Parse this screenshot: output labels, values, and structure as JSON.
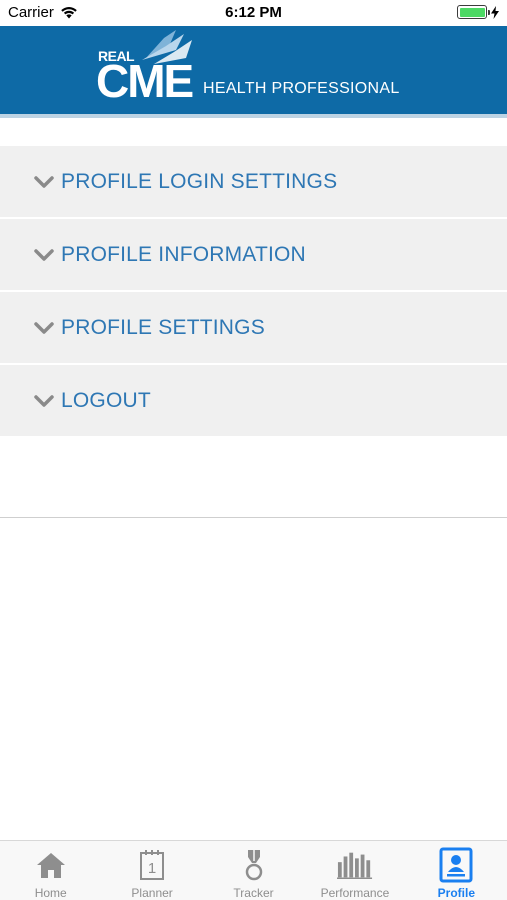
{
  "status_bar": {
    "carrier": "Carrier",
    "time": "6:12 PM",
    "wifi_icon": "wifi-icon",
    "battery_icon": "battery-icon",
    "charging_icon": "bolt-icon"
  },
  "header": {
    "logo_real": "REAL",
    "logo_cme": "CME",
    "subtitle": "HEALTH PROFESSIONAL",
    "background_color": "#0e6aa6"
  },
  "menu": {
    "items": [
      {
        "label": "PROFILE LOGIN SETTINGS",
        "icon": "chevron-down-icon"
      },
      {
        "label": "PROFILE INFORMATION",
        "icon": "chevron-down-icon"
      },
      {
        "label": "PROFILE SETTINGS",
        "icon": "chevron-down-icon"
      },
      {
        "label": "LOGOUT",
        "icon": "chevron-down-icon"
      }
    ],
    "label_color": "#2e77b4"
  },
  "tab_bar": {
    "tabs": [
      {
        "label": "Home",
        "icon": "home-icon",
        "active": false
      },
      {
        "label": "Planner",
        "icon": "calendar-icon",
        "active": false
      },
      {
        "label": "Tracker",
        "icon": "medal-icon",
        "active": false
      },
      {
        "label": "Performance",
        "icon": "bar-chart-icon",
        "active": false
      },
      {
        "label": "Profile",
        "icon": "profile-icon",
        "active": true
      }
    ],
    "active_color": "#1a7ff0",
    "inactive_color": "#8e8e8e"
  }
}
